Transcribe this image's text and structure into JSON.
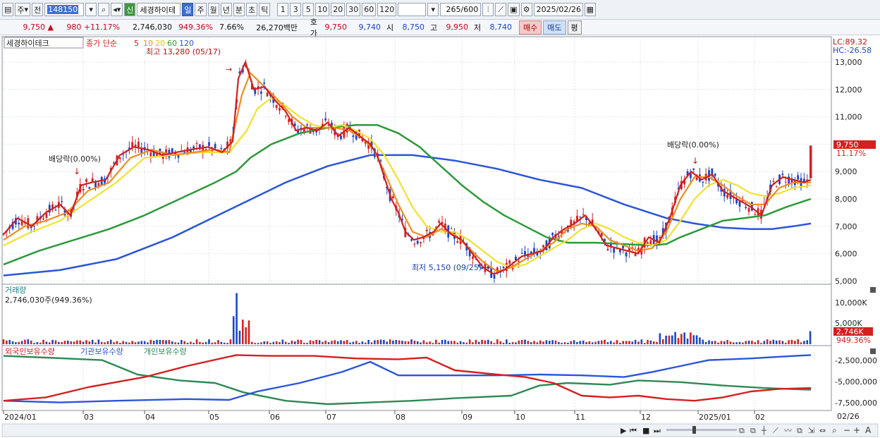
{
  "toolbar": {
    "market_sel": "주",
    "prev_label": "전",
    "code": "148150",
    "name": "세경하이테",
    "new_badge": "신",
    "periods": [
      "일",
      "주",
      "월",
      "년",
      "분",
      "초",
      "틱"
    ],
    "active_period": "일",
    "intervals": [
      "1",
      "3",
      "5",
      "10",
      "20",
      "30",
      "60",
      "120"
    ],
    "count": "265",
    "count_total": "/600",
    "date": "2025/02/26"
  },
  "quote": {
    "price": "9,750",
    "arrow": "▲",
    "change": "980",
    "change_pct": "+11.17%",
    "volume": "2,746,030",
    "volume_pct": "949.36%",
    "turnover": "7.66%",
    "amount": "26,270백만",
    "bid_label": "호가",
    "ask": "9,750",
    "bid": "9,740",
    "open_label": "시",
    "open": "8,750",
    "high_label": "고",
    "high": "9,950",
    "low_label": "저",
    "low": "8,740",
    "buy": "매수",
    "sell": "매도",
    "avg": "평"
  },
  "colors": {
    "ma5": "#d42020",
    "ma10": "#f08c1e",
    "ma20": "#f2e12c",
    "ma60": "#2d9a3a",
    "ma120": "#2a55d8",
    "up": "#d42020",
    "down": "#1a46c8",
    "foreign": "#d42020",
    "inst": "#2a55d8",
    "indiv": "#2d8a55"
  },
  "price_panel": {
    "legend_name": "세경하이테크",
    "legend_type": "종가 단순",
    "ma_labels": [
      "5",
      "10",
      "20",
      "60",
      "120"
    ],
    "lc": "LC:89.32",
    "hc": "HC:-26.58",
    "high_note": "최고 13,280 (05/17)",
    "low_note": "최저 5,150 (09/25)",
    "div_note1": "배당락(0.00%)",
    "div_note2": "배당락(0.00%)",
    "cur_price": "9,750",
    "cur_pct": "11.17%",
    "y_ticks": [
      "13,000",
      "12,000",
      "11,000",
      "10,000",
      "9,000",
      "8,000",
      "7,000",
      "6,000",
      "5,000"
    ]
  },
  "volume_panel": {
    "title": "거래량",
    "value": "2,746,030주(949.36%)",
    "y_ticks": [
      "10,000K",
      "5,000K"
    ],
    "cur_vol": "2,746K",
    "cur_pct": "949.36%"
  },
  "holdings_panel": {
    "legend": [
      "외국인보유수량",
      "기관보유수량",
      "개인보유수량"
    ],
    "y_ticks": [
      "-2,500,000",
      "-5,000,000",
      "-7,500,000"
    ]
  },
  "x_axis": {
    "labels": [
      "2024/01",
      "03",
      "04",
      "05",
      "06",
      "07",
      "08",
      "09",
      "10",
      "11",
      "12",
      "2025/01",
      "02"
    ],
    "end_label": "02/26"
  },
  "chart_data": {
    "type": "line",
    "x_range": [
      "2024/01",
      "2025/02/26"
    ],
    "price_range": [
      4800,
      13500
    ],
    "ma5": [
      [
        0,
        6.7
      ],
      [
        20,
        7.3
      ],
      [
        40,
        7.0
      ],
      [
        60,
        7.5
      ],
      [
        80,
        7.8
      ],
      [
        95,
        7.4
      ],
      [
        110,
        8.5
      ],
      [
        125,
        8.6
      ],
      [
        145,
        8.7
      ],
      [
        165,
        9.6
      ],
      [
        185,
        9.9
      ],
      [
        205,
        9.8
      ],
      [
        225,
        9.6
      ],
      [
        245,
        9.7
      ],
      [
        265,
        9.8
      ],
      [
        290,
        9.9
      ],
      [
        310,
        9.7
      ],
      [
        325,
        10.1
      ],
      [
        333,
        12.4
      ],
      [
        343,
        13.0
      ],
      [
        355,
        12.0
      ],
      [
        370,
        12.1
      ],
      [
        385,
        11.6
      ],
      [
        400,
        11.2
      ],
      [
        415,
        10.5
      ],
      [
        430,
        10.6
      ],
      [
        445,
        10.5
      ],
      [
        460,
        10.8
      ],
      [
        475,
        10.3
      ],
      [
        490,
        10.6
      ],
      [
        505,
        10.3
      ],
      [
        520,
        10.0
      ],
      [
        530,
        9.6
      ],
      [
        540,
        8.8
      ],
      [
        550,
        8.0
      ],
      [
        560,
        7.5
      ],
      [
        570,
        6.8
      ],
      [
        582,
        6.5
      ],
      [
        595,
        6.6
      ],
      [
        610,
        6.8
      ],
      [
        620,
        7.1
      ],
      [
        635,
        6.7
      ],
      [
        650,
        6.5
      ],
      [
        665,
        6.0
      ],
      [
        680,
        5.5
      ],
      [
        695,
        5.25
      ],
      [
        710,
        5.4
      ],
      [
        720,
        5.6
      ],
      [
        735,
        5.9
      ],
      [
        750,
        6.0
      ],
      [
        765,
        6.1
      ],
      [
        780,
        6.6
      ],
      [
        795,
        6.9
      ],
      [
        810,
        7.1
      ],
      [
        825,
        7.4
      ],
      [
        840,
        6.9
      ],
      [
        855,
        6.3
      ],
      [
        870,
        6.2
      ],
      [
        885,
        6.1
      ],
      [
        900,
        6.0
      ],
      [
        915,
        6.6
      ],
      [
        930,
        6.4
      ],
      [
        945,
        7.3
      ],
      [
        960,
        8.5
      ],
      [
        975,
        9.0
      ],
      [
        990,
        8.7
      ],
      [
        1005,
        8.9
      ],
      [
        1020,
        8.3
      ],
      [
        1040,
        8.0
      ],
      [
        1060,
        7.7
      ],
      [
        1075,
        7.4
      ],
      [
        1090,
        8.5
      ],
      [
        1105,
        8.8
      ],
      [
        1120,
        8.7
      ],
      [
        1135,
        8.6
      ],
      [
        1145,
        8.7
      ]
    ],
    "ma10": [
      [
        0,
        6.5
      ],
      [
        30,
        7.0
      ],
      [
        60,
        7.2
      ],
      [
        90,
        7.5
      ],
      [
        120,
        8.3
      ],
      [
        150,
        8.6
      ],
      [
        180,
        9.5
      ],
      [
        210,
        9.8
      ],
      [
        240,
        9.6
      ],
      [
        270,
        9.7
      ],
      [
        300,
        9.8
      ],
      [
        320,
        9.7
      ],
      [
        338,
        11.8
      ],
      [
        350,
        12.6
      ],
      [
        370,
        12.1
      ],
      [
        390,
        11.6
      ],
      [
        410,
        11.0
      ],
      [
        430,
        10.6
      ],
      [
        450,
        10.6
      ],
      [
        470,
        10.6
      ],
      [
        490,
        10.5
      ],
      [
        510,
        10.2
      ],
      [
        525,
        9.8
      ],
      [
        540,
        9.0
      ],
      [
        560,
        7.8
      ],
      [
        580,
        6.8
      ],
      [
        600,
        6.6
      ],
      [
        620,
        6.9
      ],
      [
        640,
        6.7
      ],
      [
        660,
        6.2
      ],
      [
        680,
        5.7
      ],
      [
        700,
        5.35
      ],
      [
        720,
        5.5
      ],
      [
        740,
        5.8
      ],
      [
        760,
        6.1
      ],
      [
        780,
        6.4
      ],
      [
        800,
        6.9
      ],
      [
        820,
        7.1
      ],
      [
        840,
        7.0
      ],
      [
        860,
        6.5
      ],
      [
        880,
        6.3
      ],
      [
        900,
        6.1
      ],
      [
        920,
        6.2
      ],
      [
        940,
        6.8
      ],
      [
        960,
        8.0
      ],
      [
        980,
        8.8
      ],
      [
        1000,
        8.8
      ],
      [
        1020,
        8.5
      ],
      [
        1040,
        8.1
      ],
      [
        1060,
        7.8
      ],
      [
        1080,
        7.8
      ],
      [
        1100,
        8.4
      ],
      [
        1120,
        8.6
      ],
      [
        1145,
        8.6
      ]
    ],
    "ma20": [
      [
        0,
        6.3
      ],
      [
        40,
        6.8
      ],
      [
        80,
        7.2
      ],
      [
        120,
        7.9
      ],
      [
        160,
        8.6
      ],
      [
        200,
        9.5
      ],
      [
        240,
        9.6
      ],
      [
        280,
        9.7
      ],
      [
        320,
        9.7
      ],
      [
        345,
        10.5
      ],
      [
        360,
        11.3
      ],
      [
        380,
        11.7
      ],
      [
        400,
        11.4
      ],
      [
        420,
        11.0
      ],
      [
        440,
        10.7
      ],
      [
        460,
        10.6
      ],
      [
        480,
        10.7
      ],
      [
        500,
        10.5
      ],
      [
        520,
        10.2
      ],
      [
        540,
        9.6
      ],
      [
        560,
        8.7
      ],
      [
        580,
        7.7
      ],
      [
        600,
        7.0
      ],
      [
        620,
        6.8
      ],
      [
        640,
        6.8
      ],
      [
        660,
        6.5
      ],
      [
        680,
        6.1
      ],
      [
        700,
        5.7
      ],
      [
        720,
        5.5
      ],
      [
        740,
        5.6
      ],
      [
        760,
        5.9
      ],
      [
        780,
        6.2
      ],
      [
        800,
        6.5
      ],
      [
        820,
        6.9
      ],
      [
        840,
        7.1
      ],
      [
        860,
        6.9
      ],
      [
        880,
        6.6
      ],
      [
        900,
        6.4
      ],
      [
        920,
        6.3
      ],
      [
        940,
        6.5
      ],
      [
        960,
        7.2
      ],
      [
        980,
        8.0
      ],
      [
        1000,
        8.5
      ],
      [
        1020,
        8.7
      ],
      [
        1040,
        8.5
      ],
      [
        1060,
        8.2
      ],
      [
        1080,
        8.1
      ],
      [
        1100,
        8.2
      ],
      [
        1120,
        8.4
      ],
      [
        1145,
        8.5
      ]
    ],
    "ma60": [
      [
        0,
        5.6
      ],
      [
        50,
        6.1
      ],
      [
        100,
        6.5
      ],
      [
        150,
        6.9
      ],
      [
        200,
        7.4
      ],
      [
        250,
        8.0
      ],
      [
        300,
        8.6
      ],
      [
        330,
        9.0
      ],
      [
        350,
        9.5
      ],
      [
        380,
        10.0
      ],
      [
        420,
        10.4
      ],
      [
        460,
        10.6
      ],
      [
        500,
        10.7
      ],
      [
        530,
        10.7
      ],
      [
        560,
        10.4
      ],
      [
        590,
        9.9
      ],
      [
        620,
        9.2
      ],
      [
        650,
        8.5
      ],
      [
        680,
        7.9
      ],
      [
        710,
        7.4
      ],
      [
        740,
        7.0
      ],
      [
        770,
        6.6
      ],
      [
        800,
        6.4
      ],
      [
        840,
        6.4
      ],
      [
        880,
        6.35
      ],
      [
        920,
        6.3
      ],
      [
        940,
        6.35
      ],
      [
        960,
        6.6
      ],
      [
        990,
        6.9
      ],
      [
        1020,
        7.2
      ],
      [
        1050,
        7.3
      ],
      [
        1080,
        7.4
      ],
      [
        1110,
        7.7
      ],
      [
        1145,
        8.0
      ]
    ],
    "ma120": [
      [
        0,
        5.2
      ],
      [
        80,
        5.4
      ],
      [
        160,
        5.8
      ],
      [
        240,
        6.6
      ],
      [
        320,
        7.6
      ],
      [
        400,
        8.6
      ],
      [
        460,
        9.2
      ],
      [
        520,
        9.6
      ],
      [
        580,
        9.6
      ],
      [
        640,
        9.4
      ],
      [
        700,
        9.1
      ],
      [
        760,
        8.7
      ],
      [
        820,
        8.4
      ],
      [
        880,
        7.8
      ],
      [
        940,
        7.3
      ],
      [
        980,
        7.1
      ],
      [
        1020,
        6.95
      ],
      [
        1060,
        6.9
      ],
      [
        1090,
        6.9
      ],
      [
        1120,
        7.0
      ],
      [
        1145,
        7.1
      ]
    ],
    "foreign_hold": [
      [
        0,
        -7.6
      ],
      [
        60,
        -7.2
      ],
      [
        120,
        -6.0
      ],
      [
        200,
        -4.8
      ],
      [
        260,
        -3.5
      ],
      [
        330,
        -2.2
      ],
      [
        380,
        -2.3
      ],
      [
        440,
        -2.3
      ],
      [
        500,
        -2.6
      ],
      [
        560,
        -2.7
      ],
      [
        600,
        -2.5
      ],
      [
        640,
        -4.0
      ],
      [
        700,
        -4.5
      ],
      [
        740,
        -4.8
      ],
      [
        780,
        -5.5
      ],
      [
        820,
        -7.0
      ],
      [
        860,
        -7.2
      ],
      [
        900,
        -7.0
      ],
      [
        940,
        -7.4
      ],
      [
        980,
        -7.6
      ],
      [
        1020,
        -7.2
      ],
      [
        1060,
        -6.5
      ],
      [
        1100,
        -6.2
      ],
      [
        1145,
        -6.1
      ]
    ],
    "inst_hold": [
      [
        0,
        -7.6
      ],
      [
        80,
        -7.8
      ],
      [
        160,
        -7.6
      ],
      [
        260,
        -7.4
      ],
      [
        320,
        -7.5
      ],
      [
        360,
        -6.5
      ],
      [
        420,
        -5.5
      ],
      [
        480,
        -4.2
      ],
      [
        520,
        -3.0
      ],
      [
        560,
        -4.6
      ],
      [
        620,
        -4.6
      ],
      [
        700,
        -4.6
      ],
      [
        760,
        -4.5
      ],
      [
        820,
        -4.6
      ],
      [
        880,
        -4.8
      ],
      [
        920,
        -4.2
      ],
      [
        960,
        -3.5
      ],
      [
        1000,
        -2.8
      ],
      [
        1060,
        -2.6
      ],
      [
        1100,
        -2.4
      ],
      [
        1145,
        -2.2
      ]
    ],
    "indiv_hold": [
      [
        0,
        -2.3
      ],
      [
        60,
        -2.5
      ],
      [
        140,
        -2.8
      ],
      [
        190,
        -4.5
      ],
      [
        250,
        -5.2
      ],
      [
        300,
        -5.5
      ],
      [
        340,
        -6.6
      ],
      [
        400,
        -7.6
      ],
      [
        460,
        -8.0
      ],
      [
        520,
        -7.8
      ],
      [
        580,
        -7.6
      ],
      [
        640,
        -7.3
      ],
      [
        720,
        -7.0
      ],
      [
        760,
        -5.8
      ],
      [
        800,
        -5.5
      ],
      [
        860,
        -5.7
      ],
      [
        900,
        -5.2
      ],
      [
        960,
        -5.4
      ],
      [
        1020,
        -5.8
      ],
      [
        1080,
        -6.1
      ],
      [
        1145,
        -6.3
      ]
    ]
  }
}
